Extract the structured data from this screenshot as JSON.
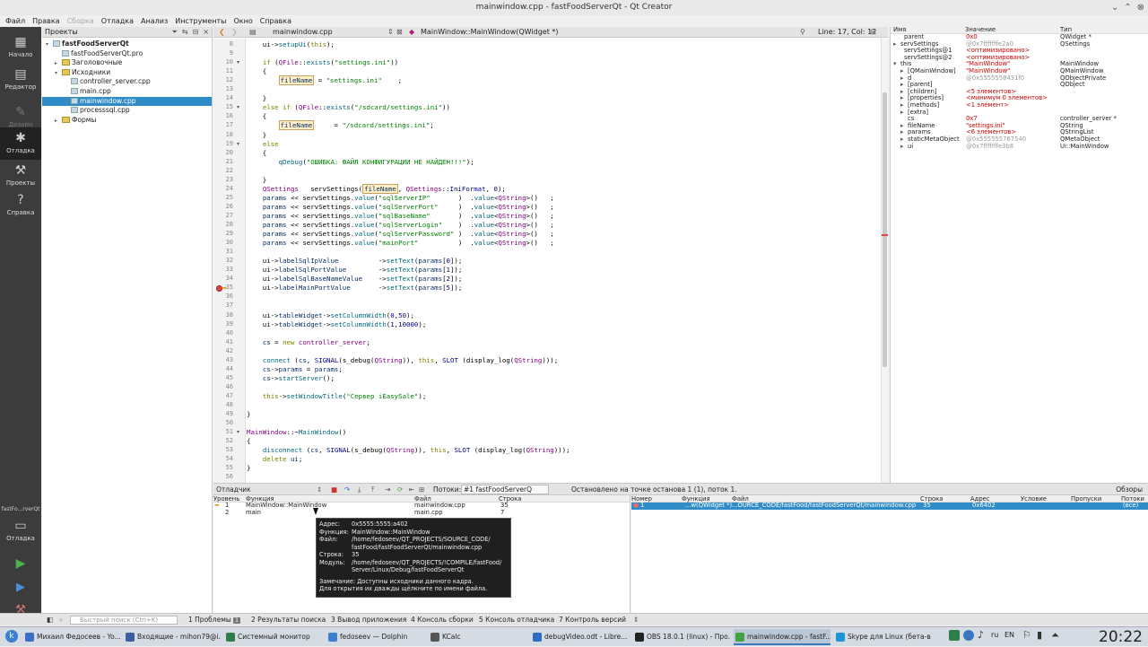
{
  "window": {
    "title": "mainwindow.cpp - fastFoodServerQt - Qt Creator"
  },
  "menu": [
    {
      "label": "Файл",
      "enabled": true
    },
    {
      "label": "Правка",
      "enabled": true
    },
    {
      "label": "Сборка",
      "enabled": false
    },
    {
      "label": "Отладка",
      "enabled": true
    },
    {
      "label": "Анализ",
      "enabled": true
    },
    {
      "label": "Инструменты",
      "enabled": true
    },
    {
      "label": "Окно",
      "enabled": true
    },
    {
      "label": "Справка",
      "enabled": true
    }
  ],
  "modes": {
    "welcome": "Начало",
    "edit": "Редактор",
    "design": "Дизайн",
    "debug": "Отладка",
    "projects": "Проекты",
    "help": "Справка",
    "kit_label": "fastFo...rverQt",
    "kit_mode": "Отладка"
  },
  "projects": {
    "title": "Проекты",
    "items": [
      {
        "label": "fastFoodServerQt",
        "level": 0,
        "type": "project",
        "expanded": true,
        "bold": true
      },
      {
        "label": "fastFoodServerQt.pro",
        "level": 1,
        "type": "file"
      },
      {
        "label": "Заголовочные",
        "level": 1,
        "type": "folder",
        "expanded": false
      },
      {
        "label": "Исходники",
        "level": 1,
        "type": "folder",
        "expanded": true
      },
      {
        "label": "controller_server.cpp",
        "level": 2,
        "type": "file"
      },
      {
        "label": "main.cpp",
        "level": 2,
        "type": "file"
      },
      {
        "label": "mainwindow.cpp",
        "level": 2,
        "type": "file",
        "selected": true
      },
      {
        "label": "processsql.cpp",
        "level": 2,
        "type": "file"
      },
      {
        "label": "Формы",
        "level": 1,
        "type": "folder",
        "expanded": false
      }
    ]
  },
  "editor": {
    "file": "mainwindow.cpp",
    "function": "MainWindow::MainWindow(QWidget *)",
    "position": "Line: 17, Col: 12",
    "lines": [
      {
        "n": "8",
        "html": "    ui-><span class='fn'>setupUi</span>(<span class='kw'>this</span>);"
      },
      {
        "n": "9",
        "html": ""
      },
      {
        "n": "10",
        "fold": true,
        "html": "    <span class='kw'>if</span> (<span class='ty'>QFile</span>::<span class='fn'>exists</span>(<span class='str'>\"settings.ini\"</span>))"
      },
      {
        "n": "11",
        "html": "    {"
      },
      {
        "n": "12",
        "html": "        <span class='hl var'>fileName</span> = <span class='str'>\"settings.ini\"</span>    ;"
      },
      {
        "n": "13",
        "html": ""
      },
      {
        "n": "14",
        "html": "    }"
      },
      {
        "n": "15",
        "fold": true,
        "html": "    <span class='kw'>else if</span> (<span class='ty'>QFile</span>::<span class='fn'>exists</span>(<span class='str'>\"/sdcard/settings.ini\"</span>))"
      },
      {
        "n": "16",
        "html": "    {"
      },
      {
        "n": "17",
        "html": "        <span class='hl var'>fileName</span>     = <span class='str'>\"/sdcard/settings.ini\"</span>;"
      },
      {
        "n": "18",
        "html": "    }"
      },
      {
        "n": "19",
        "fold": true,
        "html": "    <span class='kw'>else</span>"
      },
      {
        "n": "20",
        "html": "    {"
      },
      {
        "n": "21",
        "html": "        <span class='fn'>qDebug</span>(<span class='str'>\"ОШИБКА: ФАЙЛ КОНФИГУРАЦИИ НЕ НАЙДЕН!!!\"</span>);"
      },
      {
        "n": "22",
        "html": ""
      },
      {
        "n": "23",
        "html": "    }"
      },
      {
        "n": "24",
        "html": "    <span class='ty'>QSettings</span>   servSettings(<span class='hl var'>fileName</span>, <span class='ty'>QSettings</span>::<span class='mac'>IniFormat</span>, <span class='num'>0</span>);"
      },
      {
        "n": "25",
        "html": "    <span class='var'>params</span> << servSettings.<span class='fn'>value</span>(<span class='str'>\"sqlServerIP\"</span>       )  .<span class='fn'>value</span><<span class='ty'>QString</span>>()   ;"
      },
      {
        "n": "26",
        "html": "    <span class='var'>params</span> << servSettings.<span class='fn'>value</span>(<span class='str'>\"sqlServerPort\"</span>     )  .<span class='fn'>value</span><<span class='ty'>QString</span>>()   ;"
      },
      {
        "n": "27",
        "html": "    <span class='var'>params</span> << servSettings.<span class='fn'>value</span>(<span class='str'>\"sqlBaseName\"</span>       )  .<span class='fn'>value</span><<span class='ty'>QString</span>>()   ;"
      },
      {
        "n": "28",
        "html": "    <span class='var'>params</span> << servSettings.<span class='fn'>value</span>(<span class='str'>\"sqlServerLogin\"</span>    )  .<span class='fn'>value</span><<span class='ty'>QString</span>>()   ;"
      },
      {
        "n": "29",
        "html": "    <span class='var'>params</span> << servSettings.<span class='fn'>value</span>(<span class='str'>\"sqlServerPassword\"</span> )  .<span class='fn'>value</span><<span class='ty'>QString</span>>()   ;"
      },
      {
        "n": "30",
        "html": "    <span class='var'>params</span> << servSettings.<span class='fn'>value</span>(<span class='str'>\"mainPort\"</span>          )  .<span class='fn'>value</span><<span class='ty'>QString</span>>()   ;"
      },
      {
        "n": "31",
        "html": ""
      },
      {
        "n": "32",
        "html": "    ui-><span class='var'>labelSqlIpValue</span>          -><span class='fn'>setText</span>(<span class='var'>params</span>[<span class='num'>0</span>]);"
      },
      {
        "n": "33",
        "html": "    ui-><span class='var'>labelSqlPortValue</span>        -><span class='fn'>setText</span>(<span class='var'>params</span>[<span class='num'>1</span>]);"
      },
      {
        "n": "34",
        "html": "    ui-><span class='var'>labelSqlBaseNameValue</span>    -><span class='fn'>setText</span>(<span class='var'>params</span>[<span class='num'>2</span>]);"
      },
      {
        "n": "35",
        "bp": true,
        "html": "    ui-><span class='var'>labelMainPortValue</span>       -><span class='fn'>setText</span>(<span class='var'>params</span>[<span class='num'>5</span>]);"
      },
      {
        "n": "36",
        "html": ""
      },
      {
        "n": "37",
        "html": ""
      },
      {
        "n": "38",
        "html": "    ui-><span class='var'>tableWidget</span>-><span class='fn'>setColumnWidth</span>(<span class='num'>0</span>,<span class='num'>50</span>);"
      },
      {
        "n": "39",
        "html": "    ui-><span class='var'>tableWidget</span>-><span class='fn'>setColumnWidth</span>(<span class='num'>1</span>,<span class='num'>10000</span>);"
      },
      {
        "n": "40",
        "html": ""
      },
      {
        "n": "41",
        "html": "    <span class='var'>cs</span> = <span class='kw'>new</span> <span class='ty'>controller_server</span>;"
      },
      {
        "n": "42",
        "html": ""
      },
      {
        "n": "43",
        "html": "    <span class='fn'>connect</span> (<span class='var'>cs</span>, <span class='mac'>SIGNAL</span>(s_debug(<span class='ty'>QString</span>)), <span class='kw'>this</span>, <span class='mac'>SLOT</span> (display_log(<span class='ty'>QString</span>)));"
      },
      {
        "n": "44",
        "html": "    <span class='var'>cs</span>-><span class='var'>params</span> = <span class='var'>params</span>;"
      },
      {
        "n": "45",
        "html": "    <span class='var'>cs</span>-><span class='fn'>startServer</span>();"
      },
      {
        "n": "46",
        "html": ""
      },
      {
        "n": "47",
        "html": "    <span class='kw'>this</span>-><span class='fn'>setWindowTitle</span>(<span class='str'>\"Сервер iEasySale\"</span>);"
      },
      {
        "n": "48",
        "html": ""
      },
      {
        "n": "49",
        "html": "}"
      },
      {
        "n": "50",
        "html": ""
      },
      {
        "n": "51",
        "fold": true,
        "html": "<span class='ty'>MainWindow</span>::~<span class='fn'>MainWindow</span>()"
      },
      {
        "n": "52",
        "html": "{"
      },
      {
        "n": "53",
        "html": "    <span class='fn'>disconnect</span> (<span class='var'>cs</span>, <span class='mac'>SIGNAL</span>(s_debug(<span class='ty'>QString</span>)), <span class='kw'>this</span>, <span class='mac'>SLOT</span> (display_log(<span class='ty'>QString</span>)));"
      },
      {
        "n": "54",
        "html": "    <span class='kw'>delete</span> <span class='var'>ui</span>;"
      },
      {
        "n": "55",
        "html": "}"
      },
      {
        "n": "56",
        "html": ""
      }
    ]
  },
  "locals": {
    "headers": [
      "Имя",
      "Значение",
      "Тип"
    ],
    "rows": [
      {
        "name": "parent",
        "value": "0x0",
        "type": "QWidget *",
        "indent": 1,
        "vc": "red"
      },
      {
        "name": "servSettings",
        "value": "@0x7fffffffe2a0",
        "type": "QSettings",
        "indent": 0,
        "exp": "▸",
        "vc": "gry"
      },
      {
        "name": "servSettings@1",
        "value": "<оптимизировано>",
        "type": "",
        "indent": 1,
        "vc": "red"
      },
      {
        "name": "servSettings@2",
        "value": "<оптимизировано>",
        "type": "",
        "indent": 1,
        "vc": "red"
      },
      {
        "name": "this",
        "value": "\"MainWindow\"",
        "type": "MainWindow",
        "indent": 0,
        "exp": "▾",
        "vc": "red"
      },
      {
        "name": "[QMainWindow]",
        "value": "\"MainWindow\"",
        "type": "QMainWindow",
        "indent": 2,
        "exp": "▸",
        "vc": "red"
      },
      {
        "name": "d",
        "value": "@0x5555558431f0",
        "type": "QObjectPrivate",
        "indent": 2,
        "exp": "▸",
        "vc": "gry"
      },
      {
        "name": "[parent]",
        "value": "",
        "type": "QObject",
        "indent": 2,
        "exp": "▸",
        "vc": ""
      },
      {
        "name": "[children]",
        "value": "<5 элементов>",
        "type": "",
        "indent": 2,
        "exp": "▸",
        "vc": "red"
      },
      {
        "name": "[properties]",
        "value": "<минимум 0 элементов>",
        "type": "",
        "indent": 2,
        "exp": "▸",
        "vc": "red"
      },
      {
        "name": "[methods]",
        "value": "<1 элемент>",
        "type": "",
        "indent": 2,
        "exp": "▸",
        "vc": "red"
      },
      {
        "name": "[extra]",
        "value": "",
        "type": "",
        "indent": 2,
        "exp": "▸",
        "vc": ""
      },
      {
        "name": "cs",
        "value": "0x7",
        "type": "controller_server *",
        "indent": 2,
        "vc": "red"
      },
      {
        "name": "fileName",
        "value": "\"settings.ini\"",
        "type": "QString",
        "indent": 2,
        "exp": "▸",
        "vc": "red"
      },
      {
        "name": "params",
        "value": "<6 элементов>",
        "type": "QStringList",
        "indent": 2,
        "exp": "▸",
        "vc": "red"
      },
      {
        "name": "staticMetaObject",
        "value": "@0x555555767540",
        "type": "QMetaObject",
        "indent": 2,
        "exp": "▸",
        "vc": "gry"
      },
      {
        "name": "ui",
        "value": "@0x7fffffffe3b8",
        "type": "Ui::MainWindow",
        "indent": 2,
        "exp": "▸",
        "vc": "gry"
      }
    ]
  },
  "debugger": {
    "title": "Отладчик",
    "threads_label": "Потоки:",
    "thread_value": "#1 fastFoodServerQ",
    "status": "Остановлено на точке останова 1 (1), поток 1.",
    "views_label": "Обзоры"
  },
  "stack": {
    "headers": [
      "Уровень",
      "Функция",
      "Файл",
      "Строка"
    ],
    "rows": [
      {
        "level": "1",
        "func": "MainWindow::MainWindow",
        "file": "mainwindow.cpp",
        "line": "35"
      },
      {
        "level": "2",
        "func": "main",
        "file": "main.cpp",
        "line": "7"
      }
    ]
  },
  "breakpoints": {
    "headers": [
      "Номер",
      "Функция",
      "Файл",
      "Строка",
      "Адрес",
      "Условие",
      "Пропуски",
      "Потоки"
    ],
    "rows": [
      {
        "num": "1",
        "func": "...w(QWidget *)",
        "file": "...OURCE_CODE/fastFood/fastFoodServerQt/mainwindow.cpp",
        "line": "35",
        "addr": "0x6402",
        "cond": "",
        "ignore": "",
        "threads": "(все)"
      }
    ]
  },
  "tooltip": {
    "rows": [
      {
        "k": "Адрес:",
        "v": "0x5555:5555:a402"
      },
      {
        "k": "Функция:",
        "v": "MainWindow::MainWindow"
      },
      {
        "k": "Файл:",
        "v": "/home/fedoseev/QT_PROJECTS/SOURCE_CODE/"
      },
      {
        "k": "",
        "v": "fastFood/fastFoodServerQt/mainwindow.cpp"
      },
      {
        "k": "Строка:",
        "v": "35"
      },
      {
        "k": "Модуль:",
        "v": "/home/fedoseev/QT_PROJECTS/!COMPILE/fastFood/"
      },
      {
        "k": "",
        "v": "Server/Linux/Debug/fastFoodServerQt"
      }
    ],
    "note1": "Замечание: Доступны исходники данного кадра.",
    "note2": "Для открытия их дважды щёлкните по имени файла."
  },
  "statusbar": {
    "locator_placeholder": "Быстрый поиск (Ctrl+K)",
    "tabs": [
      {
        "num": "1",
        "label": "Проблемы",
        "badge": "1"
      },
      {
        "num": "2",
        "label": "Результаты поиска"
      },
      {
        "num": "3",
        "label": "Вывод приложения"
      },
      {
        "num": "4",
        "label": "Консоль сборки"
      },
      {
        "num": "5",
        "label": "Консоль отладчика"
      },
      {
        "num": "7",
        "label": "Контроль версий"
      }
    ]
  },
  "taskbar": {
    "tasks": [
      {
        "label": "Михаил Федосеев - Yo...",
        "color": "#3b6fc4"
      },
      {
        "label": "Входящие - mihon79@i...",
        "color": "#3a5ea0"
      },
      {
        "label": "Системный монитор",
        "color": "#2f7d4a"
      },
      {
        "label": "fedoseev — Dolphin",
        "color": "#3d7fd0"
      },
      {
        "label": "KCalc",
        "color": "#555555"
      },
      {
        "label": "debugVideo.odt - Libre...",
        "color": "#2d6cc0"
      },
      {
        "label": "OBS 18.0.1 (linux) - Про...",
        "color": "#222222"
      },
      {
        "label": "mainwindow.cpp - fastF...",
        "color": "#41a340",
        "active": true
      },
      {
        "label": "Skype для Linux (бета-в...",
        "color": "#1c95d6"
      }
    ],
    "lang": "ru",
    "layout": "EN",
    "clock": "20:22"
  }
}
